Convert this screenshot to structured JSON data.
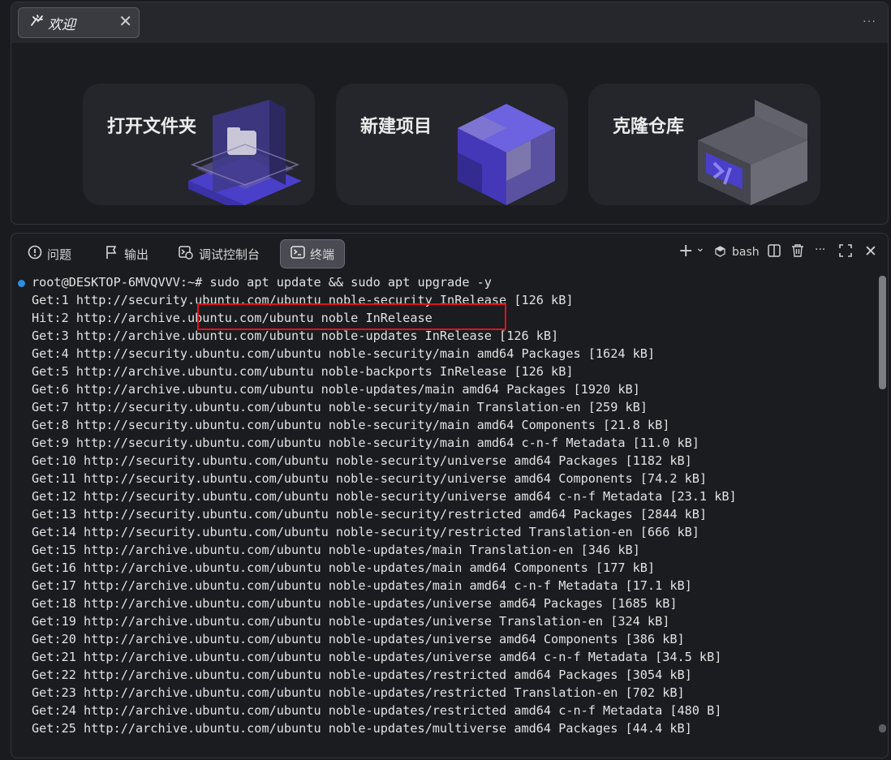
{
  "editor": {
    "tab_label": "欢迎",
    "tab_close": "✕",
    "more": "···"
  },
  "welcome": {
    "cards": [
      {
        "title": "打开文件夹",
        "icon": "folder-3d-icon"
      },
      {
        "title": "新建项目",
        "icon": "cube-3d-icon"
      },
      {
        "title": "克隆仓库",
        "icon": "repository-3d-icon"
      }
    ]
  },
  "panel": {
    "tabs": [
      {
        "label": "问题",
        "icon": "problems-icon"
      },
      {
        "label": "输出",
        "icon": "output-icon"
      },
      {
        "label": "调试控制台",
        "icon": "debug-console-icon"
      },
      {
        "label": "终端",
        "icon": "terminal-icon",
        "active": true
      }
    ],
    "toolbar": {
      "add": "+",
      "dropdown": "⌄",
      "shell_label": "bash",
      "more": "···",
      "close": "✕"
    }
  },
  "terminal": {
    "prompt": "root@DESKTOP-6MVQVVV:~# ",
    "command": "sudo apt update && sudo apt upgrade -y",
    "lines": [
      "Get:1 http://security.ubuntu.com/ubuntu noble-security InRelease [126 kB]",
      "Hit:2 http://archive.ubuntu.com/ubuntu noble InRelease",
      "Get:3 http://archive.ubuntu.com/ubuntu noble-updates InRelease [126 kB]",
      "Get:4 http://security.ubuntu.com/ubuntu noble-security/main amd64 Packages [1624 kB]",
      "Get:5 http://archive.ubuntu.com/ubuntu noble-backports InRelease [126 kB]",
      "Get:6 http://archive.ubuntu.com/ubuntu noble-updates/main amd64 Packages [1920 kB]",
      "Get:7 http://security.ubuntu.com/ubuntu noble-security/main Translation-en [259 kB]",
      "Get:8 http://security.ubuntu.com/ubuntu noble-security/main amd64 Components [21.8 kB]",
      "Get:9 http://security.ubuntu.com/ubuntu noble-security/main amd64 c-n-f Metadata [11.0 kB]",
      "Get:10 http://security.ubuntu.com/ubuntu noble-security/universe amd64 Packages [1182 kB]",
      "Get:11 http://security.ubuntu.com/ubuntu noble-security/universe amd64 Components [74.2 kB]",
      "Get:12 http://security.ubuntu.com/ubuntu noble-security/universe amd64 c-n-f Metadata [23.1 kB]",
      "Get:13 http://security.ubuntu.com/ubuntu noble-security/restricted amd64 Packages [2844 kB]",
      "Get:14 http://security.ubuntu.com/ubuntu noble-security/restricted Translation-en [666 kB]",
      "Get:15 http://archive.ubuntu.com/ubuntu noble-updates/main Translation-en [346 kB]",
      "Get:16 http://archive.ubuntu.com/ubuntu noble-updates/main amd64 Components [177 kB]",
      "Get:17 http://archive.ubuntu.com/ubuntu noble-updates/main amd64 c-n-f Metadata [17.1 kB]",
      "Get:18 http://archive.ubuntu.com/ubuntu noble-updates/universe amd64 Packages [1685 kB]",
      "Get:19 http://archive.ubuntu.com/ubuntu noble-updates/universe Translation-en [324 kB]",
      "Get:20 http://archive.ubuntu.com/ubuntu noble-updates/universe amd64 Components [386 kB]",
      "Get:21 http://archive.ubuntu.com/ubuntu noble-updates/universe amd64 c-n-f Metadata [34.5 kB]",
      "Get:22 http://archive.ubuntu.com/ubuntu noble-updates/restricted amd64 Packages [3054 kB]",
      "Get:23 http://archive.ubuntu.com/ubuntu noble-updates/restricted Translation-en [702 kB]",
      "Get:24 http://archive.ubuntu.com/ubuntu noble-updates/restricted amd64 c-n-f Metadata [480 B]",
      "Get:25 http://archive.ubuntu.com/ubuntu noble-updates/multiverse amd64 Packages [44.4 kB]"
    ]
  },
  "colors": {
    "accent": "#2f8de0",
    "highlight_border": "#e0121b",
    "purple": "#5a4fd6"
  }
}
